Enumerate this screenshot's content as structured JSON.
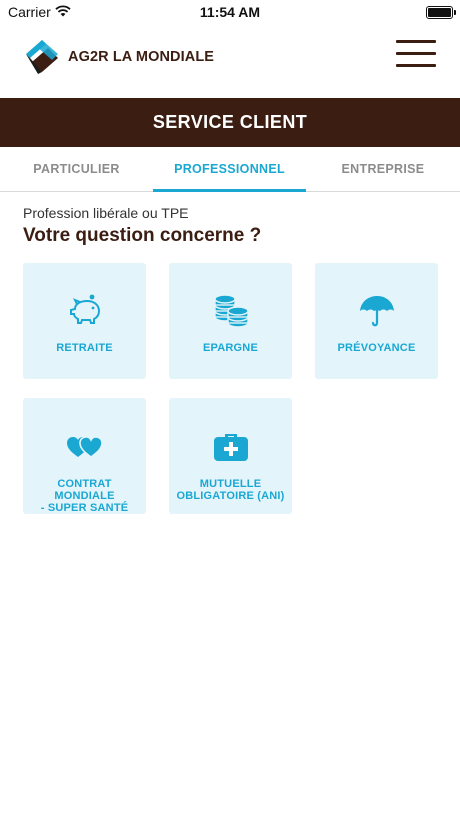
{
  "status_bar": {
    "carrier": "Carrier",
    "time": "11:54 AM"
  },
  "header": {
    "brand": "AG2R LA MONDIALE"
  },
  "title_bar": {
    "title": "SERVICE CLIENT"
  },
  "tabs": [
    {
      "label": "PARTICULIER",
      "active": false
    },
    {
      "label": "PROFESSIONNEL",
      "active": true
    },
    {
      "label": "ENTREPRISE",
      "active": false
    }
  ],
  "content": {
    "subtitle": "Profession libérale ou TPE",
    "question": "Votre question concerne ?"
  },
  "tiles": [
    {
      "label": "RETRAITE",
      "icon": "piggy-bank-icon"
    },
    {
      "label": "EPARGNE",
      "icon": "coins-icon"
    },
    {
      "label": "PRÉVOYANCE",
      "icon": "umbrella-icon"
    },
    {
      "label_line1": "CONTRAT MONDIALE",
      "label_line2": "- SUPER SANTÉ",
      "icon": "hearts-icon"
    },
    {
      "label_line1": "MUTUELLE",
      "label_line2": "OBLIGATOIRE (ANI)",
      "icon": "medical-kit-icon"
    }
  ],
  "colors": {
    "brand_brown": "#3b1d12",
    "accent_blue": "#1aa8d3",
    "tile_bg": "#e3f4fb"
  }
}
